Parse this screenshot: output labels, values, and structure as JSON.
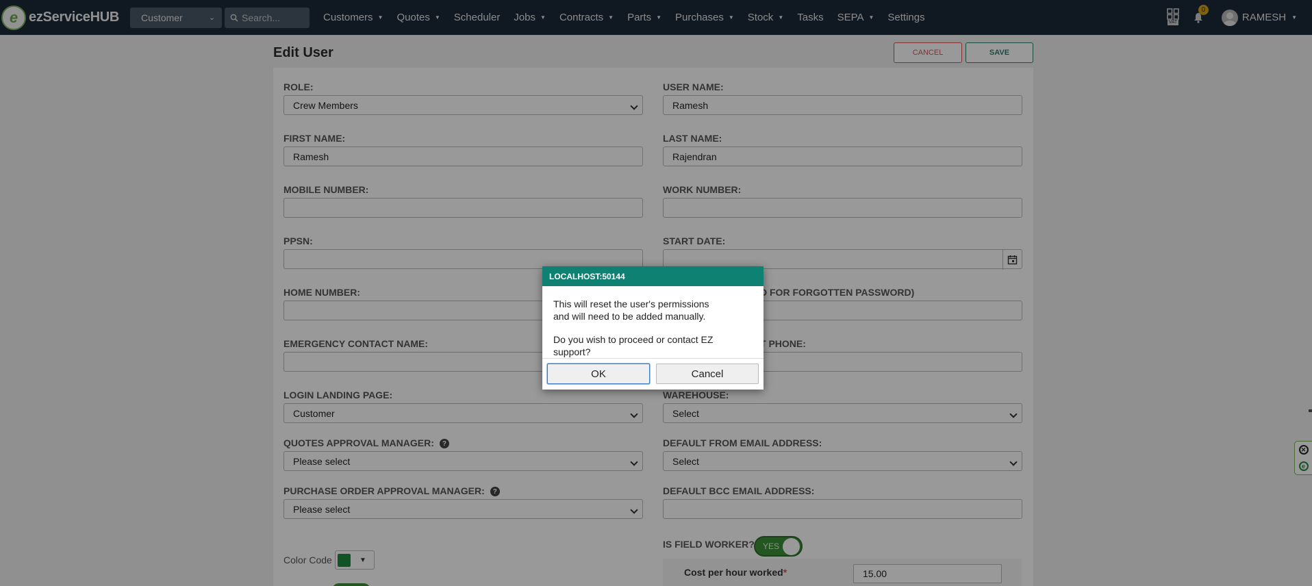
{
  "brand": {
    "logo_letter": "e",
    "name": "ezServiceHUB"
  },
  "nav": {
    "search_scope": "Customer",
    "search_placeholder": "Search...",
    "menu": [
      {
        "label": "Customers",
        "dropdown": true
      },
      {
        "label": "Quotes",
        "dropdown": true
      },
      {
        "label": "Scheduler",
        "dropdown": false
      },
      {
        "label": "Jobs",
        "dropdown": true
      },
      {
        "label": "Contracts",
        "dropdown": true
      },
      {
        "label": "Parts",
        "dropdown": true
      },
      {
        "label": "Purchases",
        "dropdown": true
      },
      {
        "label": "Stock",
        "dropdown": true
      },
      {
        "label": "Tasks",
        "dropdown": false
      },
      {
        "label": "SEPA",
        "dropdown": true
      },
      {
        "label": "Settings",
        "dropdown": false
      }
    ],
    "vat_label": "VAT",
    "notification_count": "0",
    "user_name": "RAMESH"
  },
  "page": {
    "title": "Edit User",
    "cancel_label": "CANCEL",
    "save_label": "SAVE"
  },
  "form": {
    "role_label": "ROLE:",
    "role_value": "Crew Members",
    "user_name_label": "USER NAME:",
    "user_name_value": "Ramesh",
    "first_name_label": "FIRST NAME:",
    "first_name_value": "Ramesh",
    "last_name_label": "LAST NAME:",
    "last_name_value": "Rajendran",
    "mobile_label": "MOBILE NUMBER:",
    "mobile_value": "",
    "work_label": "WORK NUMBER:",
    "work_value": "",
    "ppsn_label": "PPSN:",
    "ppsn_value": "",
    "start_date_label": "START DATE:",
    "start_date_value": "",
    "home_label": "HOME NUMBER:",
    "home_value": "",
    "email_label_visible": "D FOR FORGOTTEN PASSWORD)",
    "email_value": "",
    "emergency_name_label": "EMERGENCY CONTACT NAME:",
    "emergency_name_value": "",
    "emergency_phone_label_visible": "T PHONE:",
    "emergency_phone_value": "",
    "landing_label": "LOGIN LANDING PAGE:",
    "landing_value": "Customer",
    "warehouse_label": "WAREHOUSE:",
    "warehouse_value": "Select",
    "quotes_mgr_label": "QUOTES APPROVAL MANAGER:",
    "quotes_mgr_value": "Please select",
    "default_from_label": "DEFAULT FROM EMAIL ADDRESS:",
    "default_from_value": "Select",
    "po_mgr_label": "PURCHASE ORDER APPROVAL MANAGER:",
    "po_mgr_value": "Please select",
    "default_bcc_label": "DEFAULT BCC EMAIL ADDRESS:",
    "default_bcc_value": "",
    "color_code_label": "Color Code",
    "color_code_value": "#1f8a3f",
    "field_worker_label": "IS FIELD WORKER?",
    "field_worker_toggle": "YES",
    "cost_label": "Cost per hour worked",
    "cost_required_mark": "*",
    "cost_value": "15.00"
  },
  "dialog": {
    "title": "LOCALHOST:50144",
    "line1": "This will reset the user's permissions",
    "line2": "and will need to be added manually.",
    "line3": "Do you wish to proceed or contact EZ support?",
    "ok_label": "OK",
    "cancel_label": "Cancel"
  },
  "colors": {
    "navbar": "#1c2a3a",
    "dialog_header": "#0f8173",
    "cancel_red": "#d9534f",
    "save_green": "#2e7d6b",
    "toggle_green": "#3d8f3a"
  }
}
